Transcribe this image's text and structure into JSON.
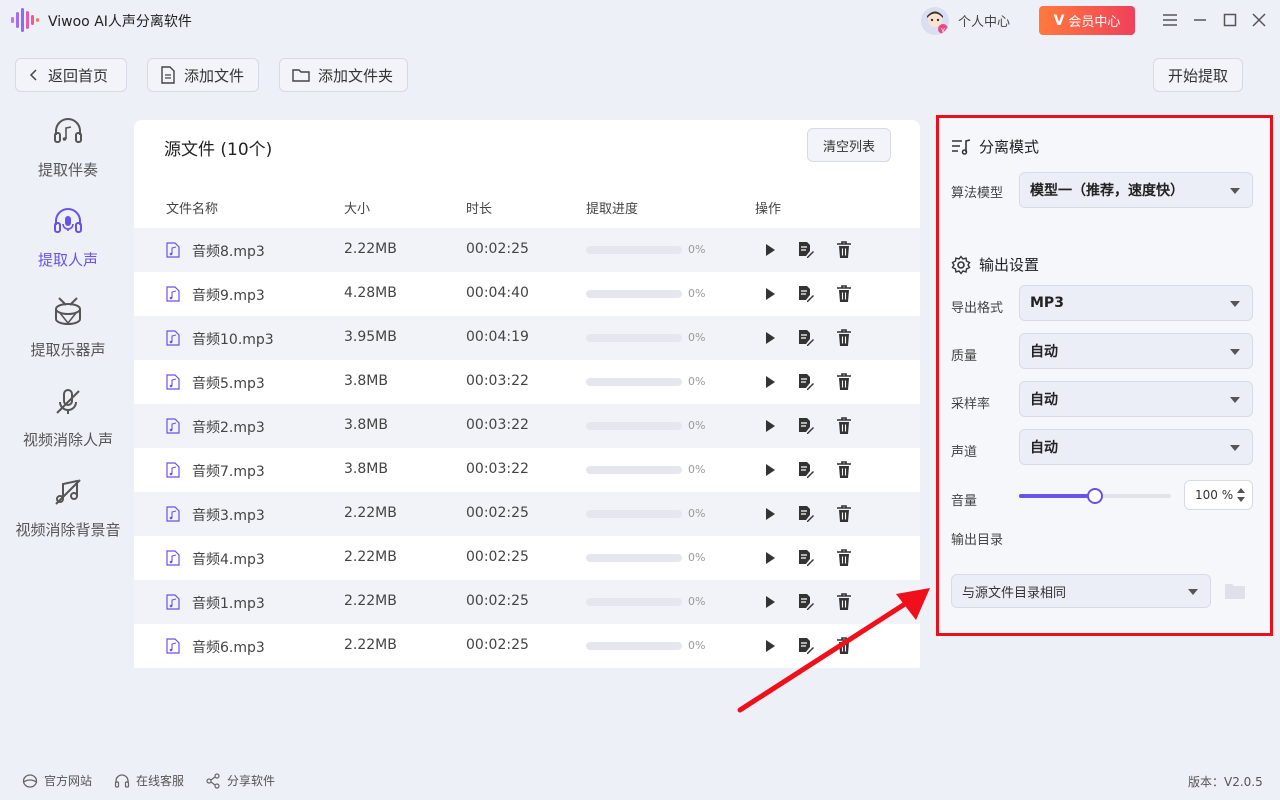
{
  "app": {
    "title": "Viwoo AI人声分离软件",
    "user_center": "个人中心",
    "vip_mark": "V",
    "vip_label": "会员中心",
    "accent_color": "#6a52e8",
    "highlight_color": "#e8111b"
  },
  "toolbar": {
    "back": "返回首页",
    "add_file": "添加文件",
    "add_folder": "添加文件夹",
    "start": "开始提取"
  },
  "sidebar": {
    "items": [
      {
        "label": "提取伴奏",
        "icon": "headphones-music-icon",
        "active": false
      },
      {
        "label": "提取人声",
        "icon": "headphones-mic-icon",
        "active": true
      },
      {
        "label": "提取乐器声",
        "icon": "drum-icon",
        "active": false
      },
      {
        "label": "视频消除人声",
        "icon": "mic-off-icon",
        "active": false
      },
      {
        "label": "视频消除背景音",
        "icon": "music-off-icon",
        "active": false
      }
    ]
  },
  "files": {
    "title": "源文件 (10个)",
    "clear": "清空列表",
    "headers": {
      "name": "文件名称",
      "size": "大小",
      "duration": "时长",
      "progress": "提取进度",
      "actions": "操作"
    },
    "rows": [
      {
        "name": "音频8.mp3",
        "size": "2.22MB",
        "duration": "00:02:25",
        "progress": "0%"
      },
      {
        "name": "音频9.mp3",
        "size": "4.28MB",
        "duration": "00:04:40",
        "progress": "0%"
      },
      {
        "name": "音频10.mp3",
        "size": "3.95MB",
        "duration": "00:04:19",
        "progress": "0%"
      },
      {
        "name": "音频5.mp3",
        "size": "3.8MB",
        "duration": "00:03:22",
        "progress": "0%"
      },
      {
        "name": "音频2.mp3",
        "size": "3.8MB",
        "duration": "00:03:22",
        "progress": "0%"
      },
      {
        "name": "音频7.mp3",
        "size": "3.8MB",
        "duration": "00:03:22",
        "progress": "0%"
      },
      {
        "name": "音频3.mp3",
        "size": "2.22MB",
        "duration": "00:02:25",
        "progress": "0%"
      },
      {
        "name": "音频4.mp3",
        "size": "2.22MB",
        "duration": "00:02:25",
        "progress": "0%"
      },
      {
        "name": "音频1.mp3",
        "size": "2.22MB",
        "duration": "00:02:25",
        "progress": "0%"
      },
      {
        "name": "音频6.mp3",
        "size": "2.22MB",
        "duration": "00:02:25",
        "progress": "0%"
      }
    ]
  },
  "settings": {
    "separation": {
      "title": "分离模式",
      "model_label": "算法模型",
      "model_value": "模型一（推荐，速度快）"
    },
    "output": {
      "title": "输出设置",
      "format_label": "导出格式",
      "format_value": "MP3",
      "quality_label": "质量",
      "quality_value": "自动",
      "samplerate_label": "采样率",
      "samplerate_value": "自动",
      "channel_label": "声道",
      "channel_value": "自动",
      "volume_label": "音量",
      "volume_value": "100 %",
      "volume_level": 0.5,
      "dir_label": "输出目录",
      "dir_value": "与源文件目录相同"
    }
  },
  "footer": {
    "website": "官方网站",
    "service": "在线客服",
    "share": "分享软件",
    "version": "版本：V2.0.5"
  }
}
